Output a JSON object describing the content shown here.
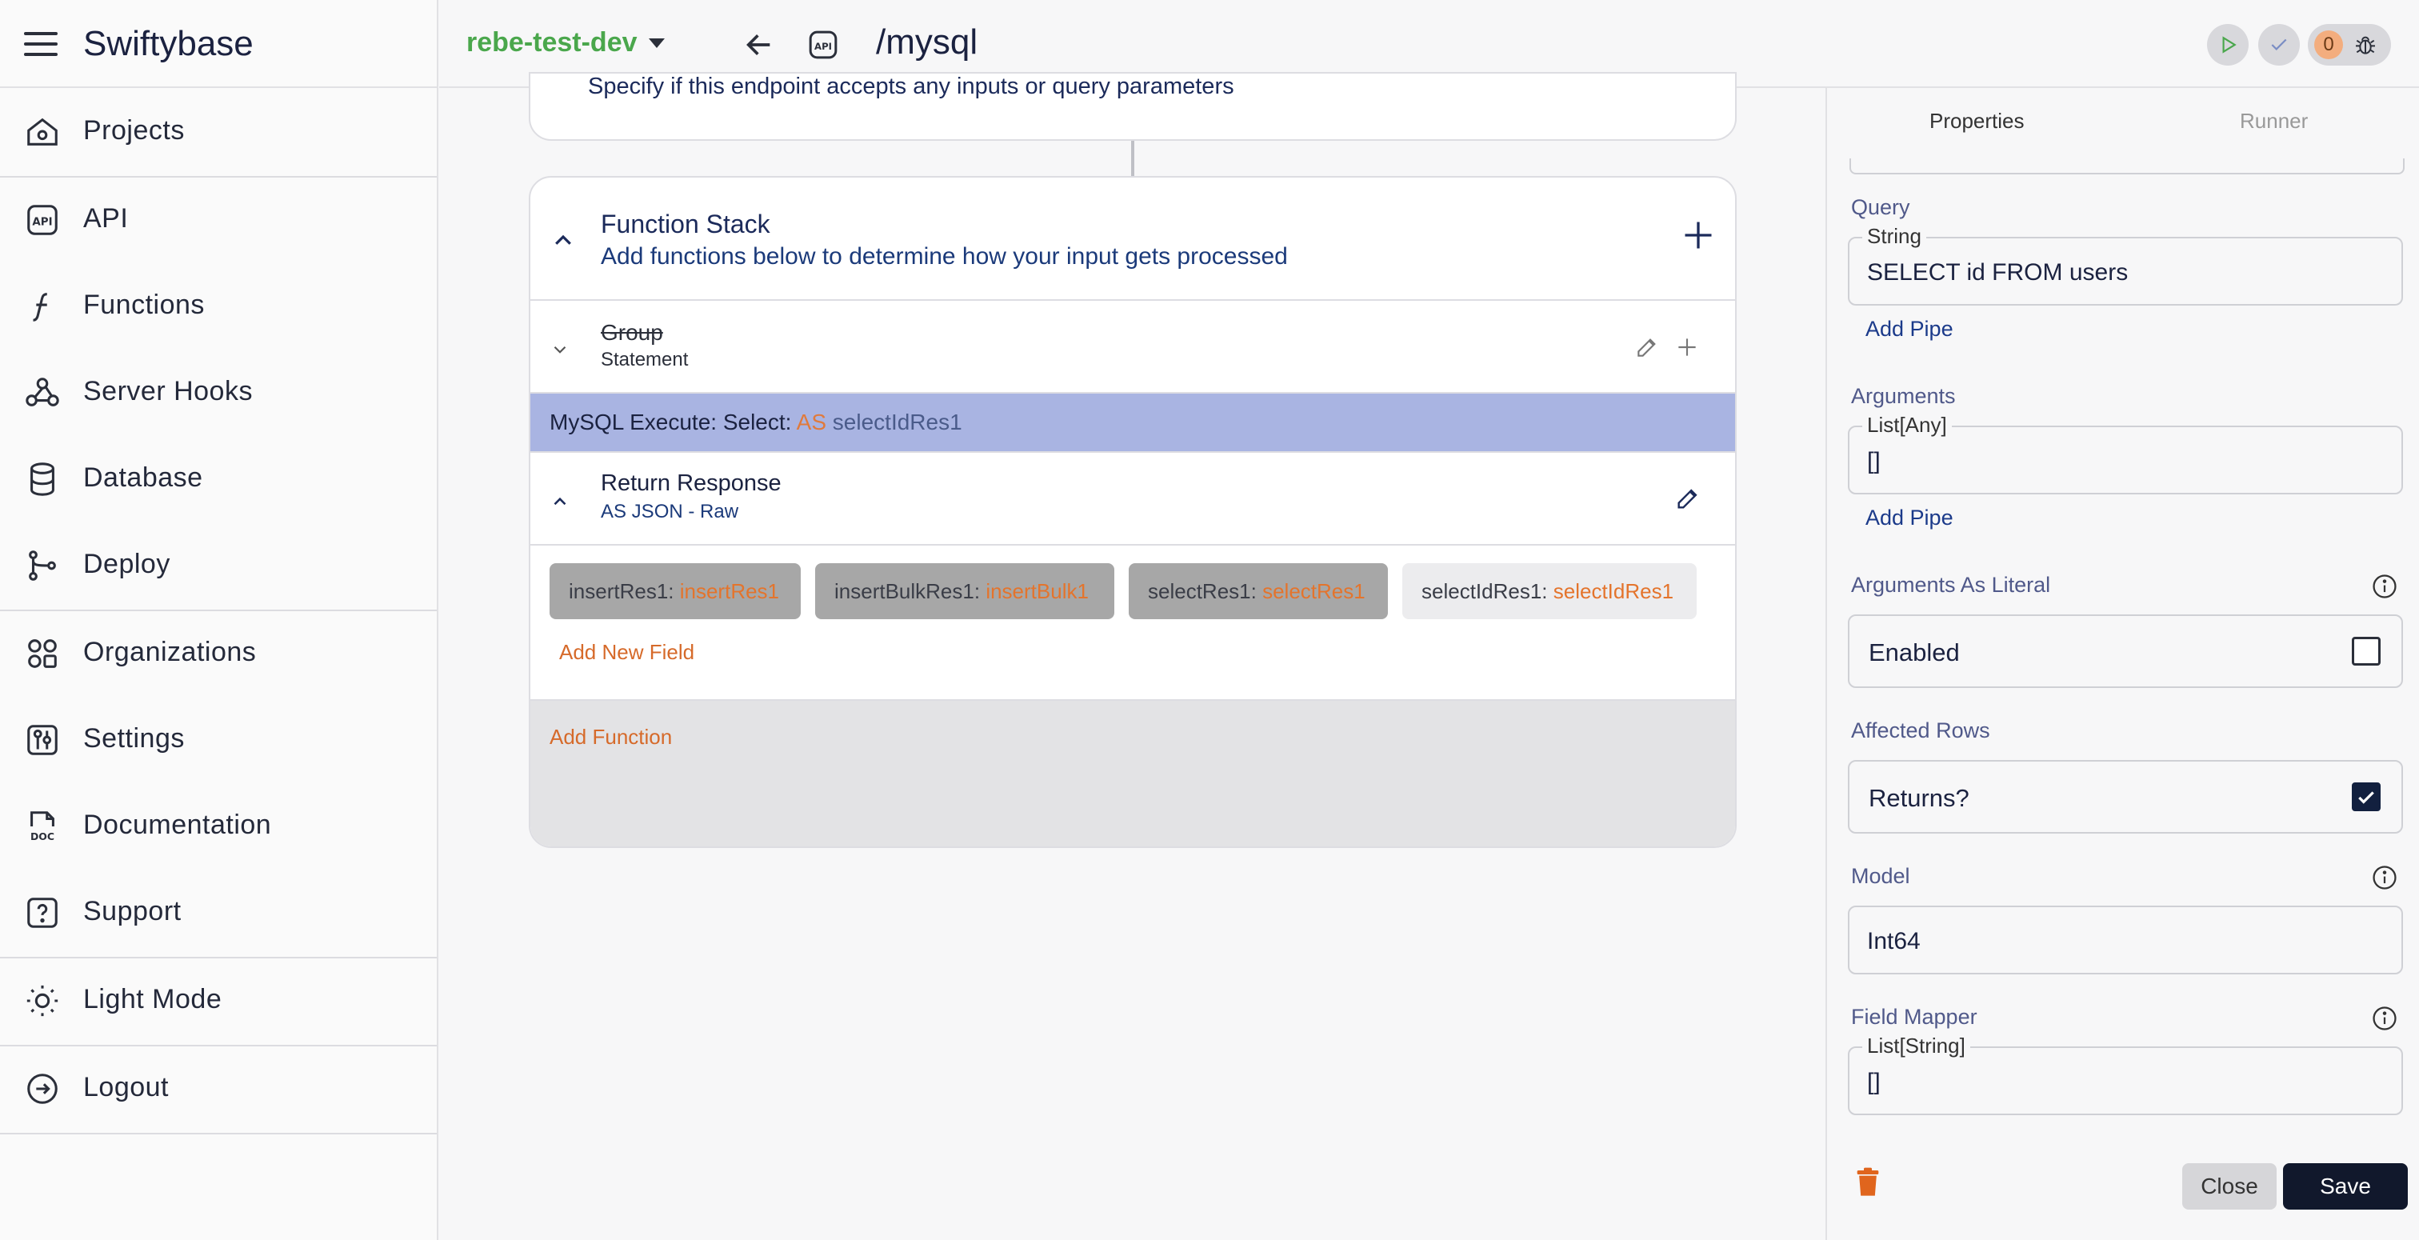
{
  "app": {
    "title": "Swiftybase"
  },
  "sidebar": {
    "items": [
      {
        "label": "Projects",
        "icon": "home-icon"
      },
      {
        "label": "API",
        "icon": "api-icon"
      },
      {
        "label": "Functions",
        "icon": "function-icon"
      },
      {
        "label": "Server Hooks",
        "icon": "webhook-icon"
      },
      {
        "label": "Database",
        "icon": "database-icon"
      },
      {
        "label": "Deploy",
        "icon": "branch-icon"
      },
      {
        "label": "Organizations",
        "icon": "organizations-icon"
      },
      {
        "label": "Settings",
        "icon": "settings-icon"
      },
      {
        "label": "Documentation",
        "icon": "doc-icon"
      },
      {
        "label": "Support",
        "icon": "help-icon"
      },
      {
        "label": "Light Mode",
        "icon": "sun-icon"
      },
      {
        "label": "Logout",
        "icon": "logout-icon"
      }
    ]
  },
  "topbar": {
    "project": "rebe-test-dev",
    "api_badge": "API",
    "path": "/mysql",
    "notification_count": "0"
  },
  "canvas": {
    "inputs_desc": "Specify if this endpoint accepts any inputs or query parameters",
    "stack": {
      "title": "Function Stack",
      "subtitle": "Add functions below to determine how your input gets processed",
      "group": {
        "name": "Group",
        "sub": "Statement"
      },
      "mysql": {
        "prefix": "MySQL Execute: Select: ",
        "as": "AS",
        "var": "selectIdRes1"
      },
      "return": {
        "title": "Return Response",
        "sub": "AS JSON - Raw"
      },
      "chips": [
        {
          "key": "insertRes1: ",
          "val": "insertRes1"
        },
        {
          "key": "insertBulkRes1: ",
          "val": "insertBulk1"
        },
        {
          "key": "selectRes1: ",
          "val": "selectRes1"
        },
        {
          "key": "selectIdRes1: ",
          "val": "selectIdRes1"
        }
      ],
      "add_field": "Add New Field",
      "add_function": "Add Function"
    }
  },
  "panel": {
    "tabs": {
      "properties": "Properties",
      "runner": "Runner"
    },
    "query": {
      "label": "Query",
      "type": "String",
      "value": "SELECT id FROM users",
      "add_pipe": "Add Pipe"
    },
    "arguments": {
      "label": "Arguments",
      "type": "List[Any]",
      "value": "[]",
      "add_pipe": "Add Pipe"
    },
    "args_literal": {
      "label": "Arguments As Literal",
      "value": "Enabled",
      "checked": false
    },
    "affected_rows": {
      "label": "Affected Rows",
      "value": "Returns?",
      "checked": true
    },
    "model": {
      "label": "Model",
      "value": "Int64"
    },
    "field_mapper": {
      "label": "Field Mapper",
      "type": "List[String]",
      "value": "[]"
    },
    "buttons": {
      "close": "Close",
      "save": "Save"
    }
  },
  "colors": {
    "accent": "#4aa74c",
    "selected_row": "#a9b4e2",
    "orange": "#e4742c",
    "save": "#11182c"
  }
}
